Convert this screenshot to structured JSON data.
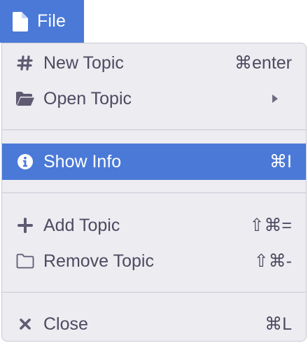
{
  "colors": {
    "accent": "#4a79d8",
    "menu_background": "#ececf1",
    "text": "#4f4a60",
    "separator": "#c9c9d4"
  },
  "tab": {
    "label": "File",
    "icon": "file-icon"
  },
  "menu": {
    "items": [
      {
        "label": "New Topic",
        "shortcut": "⌘enter",
        "icon": "hash-icon"
      },
      {
        "label": "Open Topic",
        "shortcut": "",
        "icon": "folder-open-icon",
        "submenu": true
      },
      {
        "label": "Show Info",
        "shortcut": "⌘I",
        "icon": "info-circle-icon",
        "highlighted": true
      },
      {
        "label": "Add Topic",
        "shortcut": "⇧⌘=",
        "icon": "plus-icon"
      },
      {
        "label": "Remove Topic",
        "shortcut": "⇧⌘-",
        "icon": "folder-outline-icon"
      },
      {
        "label": "Close",
        "shortcut": "⌘L",
        "icon": "close-x-icon"
      }
    ]
  }
}
